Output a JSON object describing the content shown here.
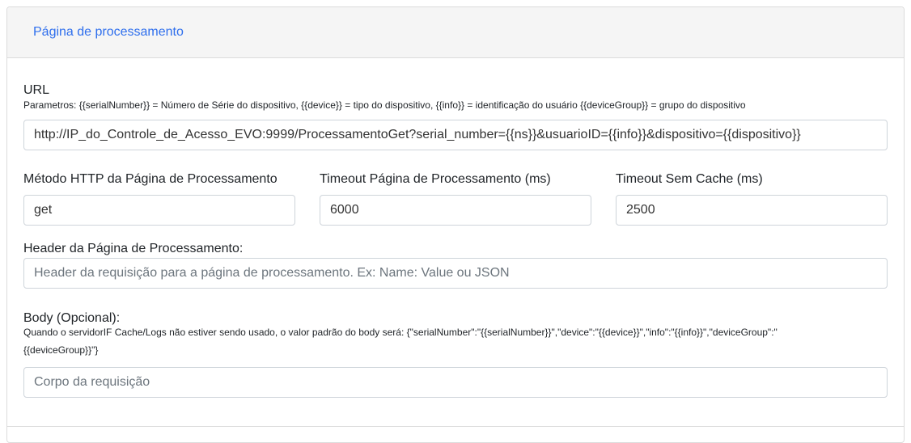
{
  "header": {
    "title": "Página de processamento"
  },
  "url": {
    "label": "URL",
    "help": "Parametros: {{serialNumber}} = Número de Série do dispositivo, {{device}} = tipo do dispositivo, {{info}} = identificação do usuário {{deviceGroup}} = grupo do dispositivo",
    "value": "http://IP_do_Controle_de_Acesso_EVO:9999/ProcessamentoGet?serial_number={{ns}}&usuarioID={{info}}&dispositivo={{dispositivo}}"
  },
  "method": {
    "label": "Método HTTP da Página de Processamento",
    "value": "get"
  },
  "timeout": {
    "label": "Timeout Página de Processamento (ms)",
    "value": "6000"
  },
  "timeout_nocache": {
    "label": "Timeout Sem Cache (ms)",
    "value": "2500"
  },
  "headers": {
    "label": "Header da Página de Processamento:",
    "placeholder": "Header da requisição para a página de processamento. Ex: Name: Value ou JSON"
  },
  "body": {
    "label": "Body (Opcional):",
    "help_line1": "Quando o servidorIF Cache/Logs não estiver sendo usado, o valor padrão do body será: {\"serialNumber\":\"{{serialNumber}}\",\"device\":\"{{device}}\",\"info\":\"{{info}}\",\"deviceGroup\":\"",
    "help_line2": "{{deviceGroup}}\"}",
    "placeholder": "Corpo da requisição"
  }
}
